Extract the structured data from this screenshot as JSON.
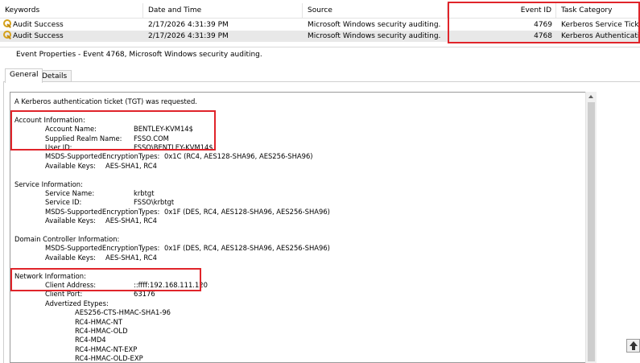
{
  "event_list": {
    "columns": [
      "Keywords",
      "Date and Time",
      "Source",
      "Event ID",
      "Task Category"
    ],
    "rows": [
      {
        "keywords": "Audit Success",
        "date_time": "2/17/2026 4:31:39 PM",
        "source": "Microsoft Windows security auditing.",
        "event_id": "4769",
        "task_category": "Kerberos Service Ticke"
      },
      {
        "keywords": "Audit Success",
        "date_time": "2/17/2026 4:31:39 PM",
        "source": "Microsoft Windows security auditing.",
        "event_id": "4768",
        "task_category": "Kerberos Authenticatio"
      }
    ]
  },
  "properties": {
    "title": "Event Properties - Event 4768, Microsoft Windows security auditing.",
    "tabs": [
      "General",
      "Details"
    ],
    "active_tab": "General",
    "lines": [
      {
        "indent": 0,
        "label": "A Kerberos authentication ticket (TGT) was requested.",
        "value": ""
      },
      {
        "indent": 0,
        "label": "",
        "value": ""
      },
      {
        "indent": 0,
        "label": "Account Information:",
        "value": ""
      },
      {
        "indent": 1,
        "label": "Account Name:",
        "value": "BENTLEY-KVM14$"
      },
      {
        "indent": 1,
        "label": "Supplied Realm Name:",
        "value": "FSSO.COM"
      },
      {
        "indent": 1,
        "label": "User ID:",
        "value": "FSSO\\BENTLEY-KVM14$"
      },
      {
        "indent": 1,
        "label": "MSDS-SupportedEncryptionTypes:",
        "value": "0x1C (RC4, AES128-SHA96, AES256-SHA96)"
      },
      {
        "indent": 1,
        "label": "Available Keys:",
        "value": "AES-SHA1, RC4"
      },
      {
        "indent": 0,
        "label": "",
        "value": ""
      },
      {
        "indent": 0,
        "label": "Service Information:",
        "value": ""
      },
      {
        "indent": 1,
        "label": "Service Name:",
        "value": "krbtgt"
      },
      {
        "indent": 1,
        "label": "Service ID:",
        "value": "FSSO\\krbtgt"
      },
      {
        "indent": 1,
        "label": "MSDS-SupportedEncryptionTypes:",
        "value": "0x1F (DES, RC4, AES128-SHA96, AES256-SHA96)"
      },
      {
        "indent": 1,
        "label": "Available Keys:",
        "value": "AES-SHA1, RC4"
      },
      {
        "indent": 0,
        "label": "",
        "value": ""
      },
      {
        "indent": 0,
        "label": "Domain Controller Information:",
        "value": ""
      },
      {
        "indent": 1,
        "label": "MSDS-SupportedEncryptionTypes:",
        "value": "0x1F (DES, RC4, AES128-SHA96, AES256-SHA96)"
      },
      {
        "indent": 1,
        "label": "Available Keys:",
        "value": "AES-SHA1, RC4"
      },
      {
        "indent": 0,
        "label": "",
        "value": ""
      },
      {
        "indent": 0,
        "label": "Network Information:",
        "value": ""
      },
      {
        "indent": 1,
        "label": "Client Address:",
        "value": "::ffff:192.168.111.120"
      },
      {
        "indent": 1,
        "label": "Client Port:",
        "value": "63176"
      },
      {
        "indent": 1,
        "label": "Advertized Etypes:",
        "value": ""
      },
      {
        "indent": 2,
        "label": "AES256-CTS-HMAC-SHA1-96",
        "value": ""
      },
      {
        "indent": 2,
        "label": "RC4-HMAC-NT",
        "value": ""
      },
      {
        "indent": 2,
        "label": "RC4-HMAC-OLD",
        "value": ""
      },
      {
        "indent": 2,
        "label": "RC4-MD4",
        "value": ""
      },
      {
        "indent": 2,
        "label": "RC4-HMAC-NT-EXP",
        "value": ""
      },
      {
        "indent": 2,
        "label": "RC4-HMAC-OLD-EXP",
        "value": ""
      }
    ]
  },
  "icons": {
    "row_icon": "key-icon",
    "window_icon": "event-properties-icon",
    "scroll_up": "arrow-up-icon"
  },
  "colors": {
    "highlight_box": "#e0242a",
    "selected_row": "#e8e8e8"
  }
}
